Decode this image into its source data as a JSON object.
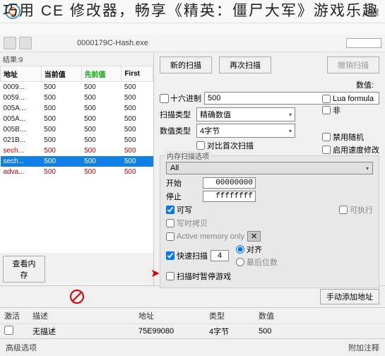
{
  "overlay_title": "巧用 CE 修改器，畅享《精英：僵尸大军》游戏乐趣",
  "process_name": "0000179C-Hash.exe",
  "settings_label": "设置",
  "result_count_label": "结果:9",
  "addr_table": {
    "headers": {
      "address": "地址",
      "current": "当前值",
      "previous": "先前值",
      "first": "First"
    },
    "rows": [
      {
        "addr": "0009...",
        "cur": "500",
        "prev": "500",
        "first": "500",
        "kind": "normal"
      },
      {
        "addr": "0059...",
        "cur": "500",
        "prev": "500",
        "first": "500",
        "kind": "normal"
      },
      {
        "addr": "005A...",
        "cur": "500",
        "prev": "500",
        "first": "500",
        "kind": "normal"
      },
      {
        "addr": "005A...",
        "cur": "500",
        "prev": "500",
        "first": "500",
        "kind": "normal"
      },
      {
        "addr": "005B...",
        "cur": "500",
        "prev": "500",
        "first": "500",
        "kind": "normal"
      },
      {
        "addr": "021B...",
        "cur": "500",
        "prev": "500",
        "first": "500",
        "kind": "normal"
      },
      {
        "addr": "sech...",
        "cur": "500",
        "prev": "500",
        "first": "500",
        "kind": "red"
      },
      {
        "addr": "sech...",
        "cur": "500",
        "prev": "500",
        "first": "500",
        "kind": "selected"
      },
      {
        "addr": "adva...",
        "cur": "500",
        "prev": "500",
        "first": "500",
        "kind": "red"
      }
    ]
  },
  "buttons": {
    "view_memory": "查看内存",
    "new_scan": "新的扫描",
    "next_scan": "再次扫描",
    "undo_scan": "撤销扫描",
    "manual_add": "手动添加地址"
  },
  "scan": {
    "value_label": "数值:",
    "hex_label": "十六进制",
    "value": "500",
    "scan_type_label": "扫描类型",
    "scan_type": "精确数值",
    "value_type_label": "数值类型",
    "value_type": "4字节",
    "compare_first_label": "对比首次扫描",
    "lua_label": "Lua formula",
    "not_label": "非",
    "no_random_label": "禁用随机",
    "enable_speed_label": "启用速度修改"
  },
  "mem_opts": {
    "panel_label": "内存扫描选项",
    "all_label": "All",
    "start_label": "开始",
    "start": "00000000",
    "stop_label": "停止",
    "stop": "ffffffff",
    "writable_label": "可写",
    "executable_label": "可执行",
    "copy_on_write_label": "写时拷贝",
    "active_mem_label": "Active memory only",
    "fast_scan_label": "快速扫描",
    "fast_scan": "4",
    "aligned_label": "对齐",
    "last_digits_label": "最后位数",
    "pause_label": "扫描时暂停游戏"
  },
  "cheat_table": {
    "headers": {
      "active": "激活",
      "desc": "描述",
      "addr": "地址",
      "type": "类型",
      "value": "数值"
    },
    "row": {
      "desc": "无描述",
      "addr": "75E99080",
      "type": "4字节",
      "value": "500"
    }
  },
  "footer": {
    "advanced": "高级选项",
    "comment": "附加注释"
  }
}
